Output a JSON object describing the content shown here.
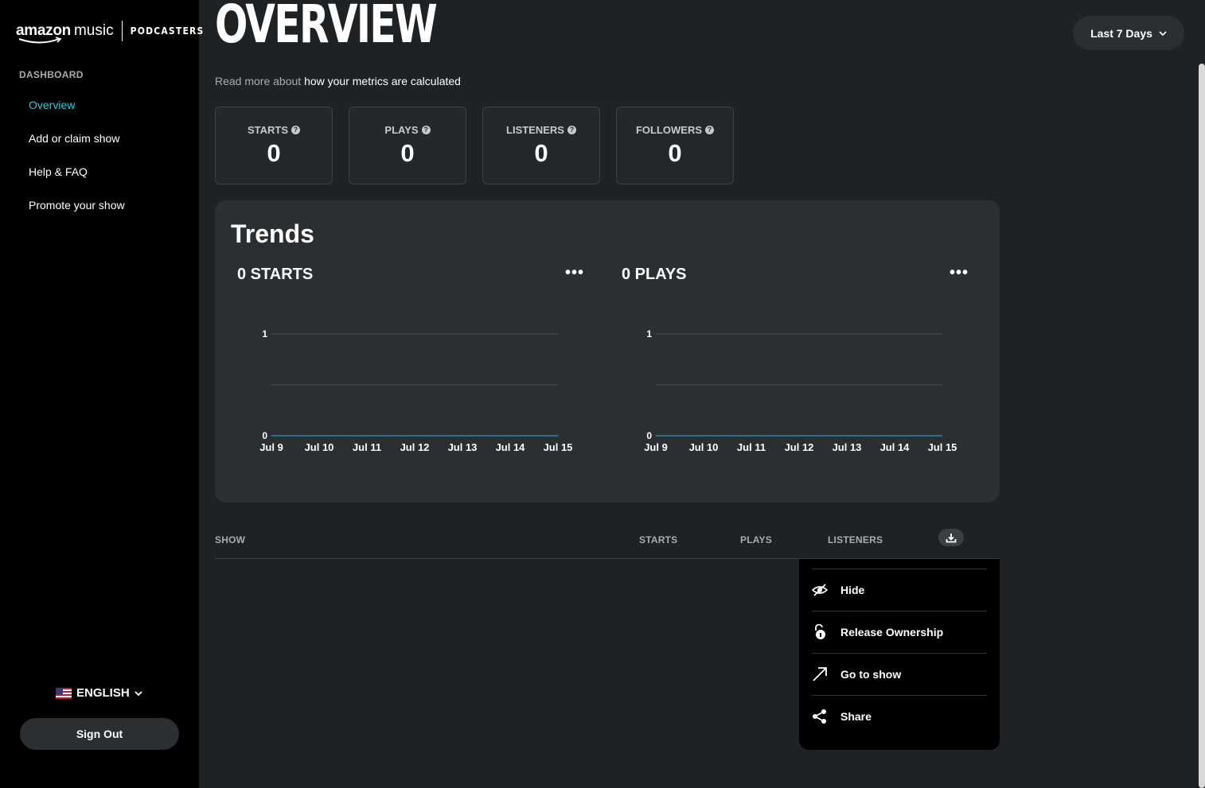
{
  "sidebar": {
    "logo": {
      "brand": "amazon",
      "product": "music",
      "sub": "PODCASTERS"
    },
    "section": "DASHBOARD",
    "items": [
      {
        "label": "Overview"
      },
      {
        "label": "Add or claim show"
      },
      {
        "label": "Help & FAQ"
      },
      {
        "label": "Promote your show"
      }
    ],
    "language": "ENGLISH",
    "sign_out": "Sign Out"
  },
  "header": {
    "title": "OVERVIEW",
    "range": "Last 7 Days",
    "read_more_prefix": "Read more about",
    "read_more_link": "how your metrics are calculated"
  },
  "stats": [
    {
      "label": "STARTS",
      "value": "0"
    },
    {
      "label": "PLAYS",
      "value": "0"
    },
    {
      "label": "LISTENERS",
      "value": "0"
    },
    {
      "label": "FOLLOWERS",
      "value": "0"
    }
  ],
  "trends": {
    "title": "Trends",
    "more_icon": "more-horizontal-icon"
  },
  "chart_data": [
    {
      "type": "line",
      "title": "0 STARTS",
      "x": [
        "Jul 9",
        "Jul 10",
        "Jul 11",
        "Jul 12",
        "Jul 13",
        "Jul 14",
        "Jul 15"
      ],
      "series": [
        {
          "values": [
            0,
            0,
            0,
            0,
            0,
            0,
            0
          ]
        }
      ],
      "y_ticks": [
        "1",
        "0"
      ],
      "ylim": [
        0,
        1
      ],
      "grid": true,
      "line_color": "#2a6f87"
    },
    {
      "type": "line",
      "title": "0 PLAYS",
      "x": [
        "Jul 9",
        "Jul 10",
        "Jul 11",
        "Jul 12",
        "Jul 13",
        "Jul 14",
        "Jul 15"
      ],
      "series": [
        {
          "values": [
            0,
            0,
            0,
            0,
            0,
            0,
            0
          ]
        }
      ],
      "y_ticks": [
        "1",
        "0"
      ],
      "ylim": [
        0,
        1
      ],
      "grid": true,
      "line_color": "#2a6f87"
    }
  ],
  "table": {
    "headers": {
      "show": "SHOW",
      "starts": "STARTS",
      "plays": "PLAYS",
      "listeners": "LISTENERS"
    },
    "download_icon": "download-icon"
  },
  "menu": {
    "items": [
      {
        "label": "Hide",
        "icon": "eye-off-icon"
      },
      {
        "label": "Release Ownership",
        "icon": "unlock-icon"
      },
      {
        "label": "Go to show",
        "icon": "arrow-up-right-icon"
      },
      {
        "label": "Share",
        "icon": "share-icon"
      }
    ]
  },
  "colors": {
    "accent": "#25d1da",
    "background": "#1f2224",
    "sidebar": "#000000",
    "card": "#2b2f32"
  }
}
